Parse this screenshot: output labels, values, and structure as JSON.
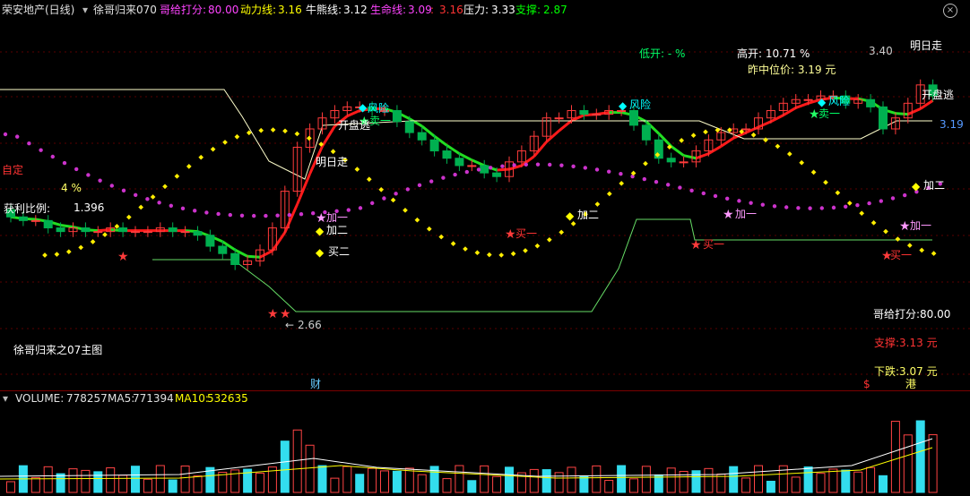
{
  "header": {
    "stock": "荣安地产(日线)",
    "indicator": "徐哥归来070",
    "score_label": "哥给打分:",
    "score_value": "80.00",
    "power_label": "动力线:",
    "power_value": "3.16",
    "bull_label": "牛熊线:",
    "bull_value": "3.12",
    "life_label": "生命线:",
    "life_value": "3.09",
    "life_value2": "3.16",
    "resist_label": "压力:",
    "resist_value": "3.33",
    "support_label": "支撑:",
    "support_value": "2.87"
  },
  "chart": {
    "low_open": "低开: -  %",
    "high_open": "高开:  10.71 %",
    "yesterday_mid": "昨中位价:  3.19 元",
    "price_hi": "3.40",
    "price_lo": "2.66",
    "price_current": "3.19",
    "right_score": "哥给打分:80.00",
    "right_support": "支撑:3.13 元",
    "right_fall": "下跌:3.07 元",
    "main_title": "徐哥归来之07主图",
    "ming_ri_zou": "明日走",
    "kai_pan_tao": "开盘逃",
    "fengxian": "风险",
    "mai_yi": "卖一",
    "mai_yi_buy": "买一",
    "mai_er_buy": "买二",
    "jia_yi": "加一",
    "jia_er": "加二",
    "zi_ding": "自定",
    "huo_li": "获利比例:",
    "huo_li_value": "1.396",
    "zi_ding_value": "4 %",
    "cai_marker": "财",
    "gang_marker": "港",
    "dollar_marker": "$"
  },
  "colors": {
    "up": "#ff3b3b",
    "down": "#00b050",
    "bull": "#ff1a1a",
    "bear": "#22dd22",
    "dots_yellow": "#ffee00",
    "dots_magenta": "#cc33cc",
    "accent_cyan": "#00ffff"
  },
  "volume": {
    "label": "VOLUME:",
    "value": "778257",
    "ma5_label": "MA5:",
    "ma5_value": "771394",
    "ma10_label": "MA10:",
    "ma10_value": "532635"
  }
}
